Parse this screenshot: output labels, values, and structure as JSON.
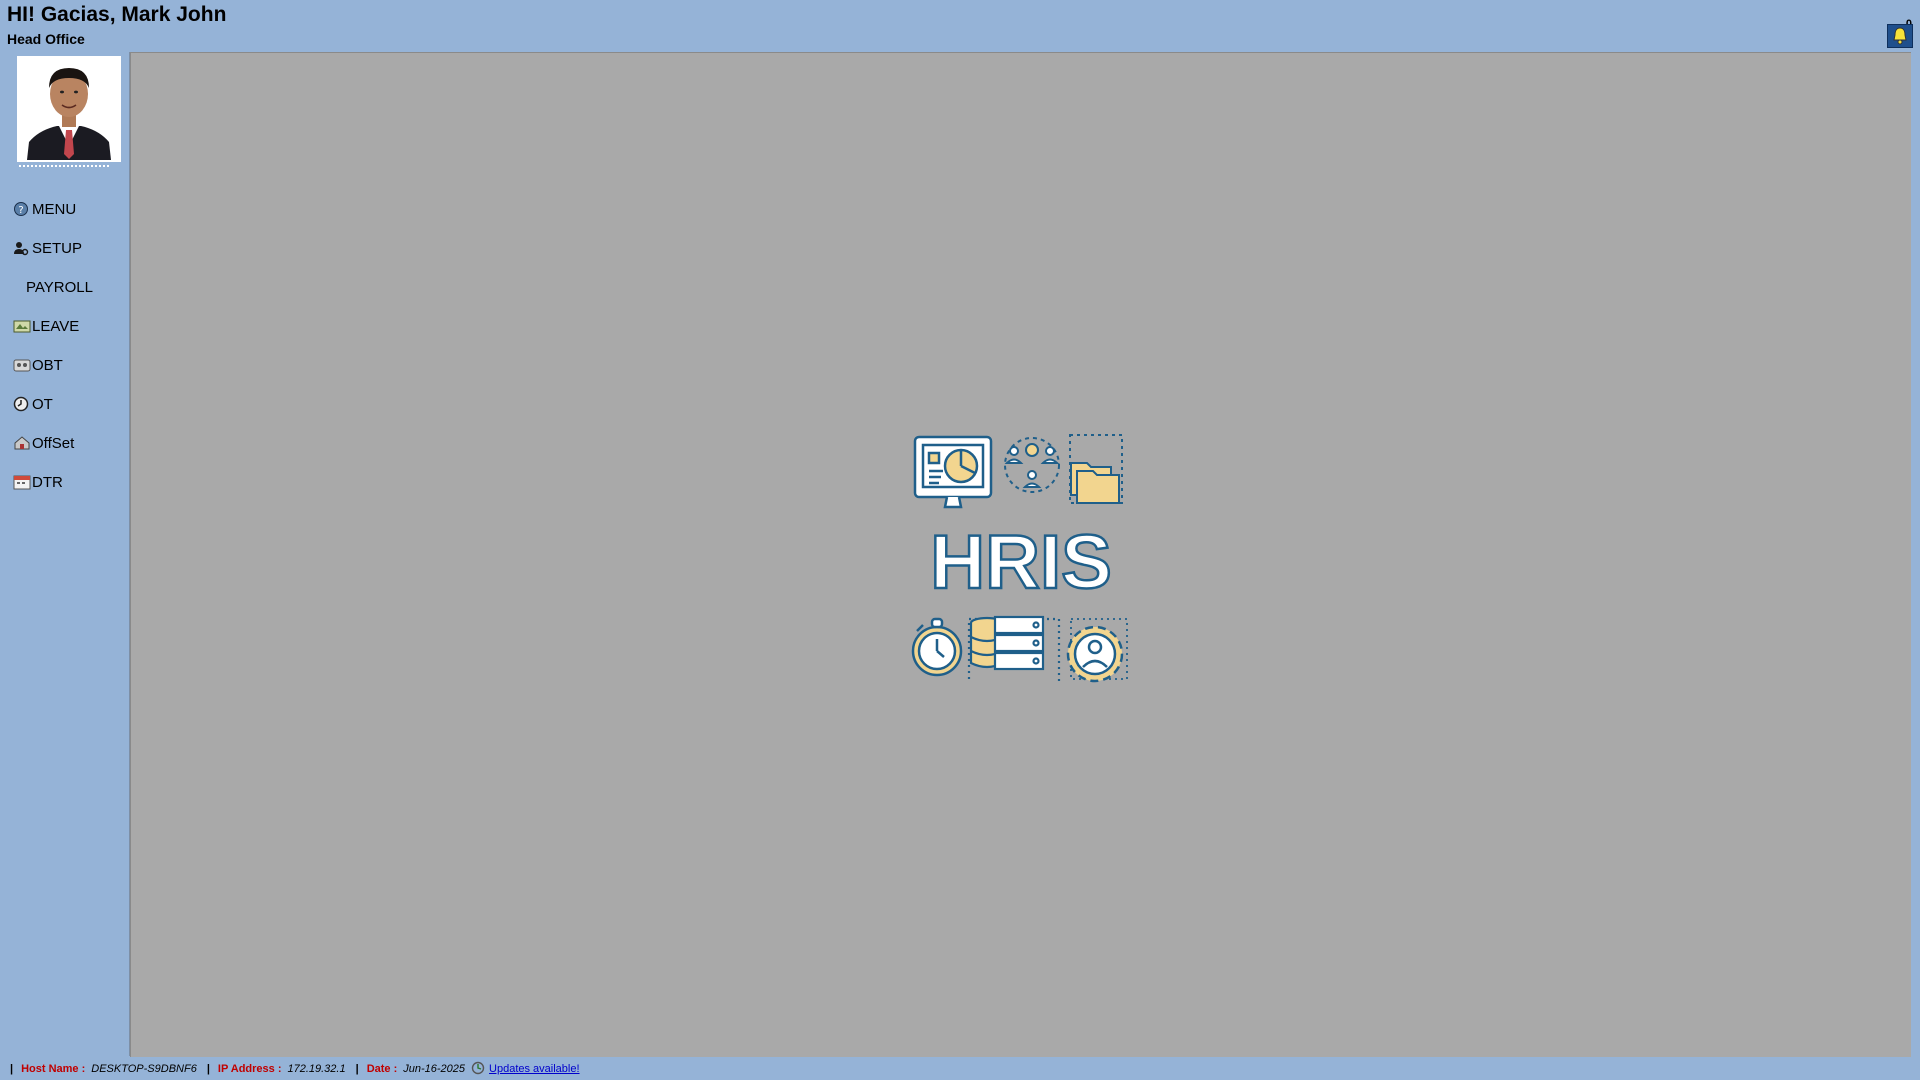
{
  "header": {
    "greeting": "HI! Gacias, Mark John",
    "office": "Head Office",
    "notification_count": "0"
  },
  "sidebar": {
    "items": [
      {
        "label": "MENU",
        "icon": "menu-icon"
      },
      {
        "label": "SETUP",
        "icon": "user-gear-icon"
      },
      {
        "label": "PAYROLL",
        "icon": ""
      },
      {
        "label": "LEAVE",
        "icon": "leave-icon"
      },
      {
        "label": "OBT",
        "icon": "obt-icon"
      },
      {
        "label": "OT",
        "icon": "clock-icon"
      },
      {
        "label": "OffSet",
        "icon": "offset-icon"
      },
      {
        "label": "DTR",
        "icon": "calendar-icon"
      }
    ]
  },
  "main": {
    "logo_text": "HRIS"
  },
  "statusbar": {
    "host_label": "Host Name :",
    "host_value": "DESKTOP-S9DBNF6",
    "ip_label": "IP Address :",
    "ip_value": "172.19.32.1",
    "date_label": "Date :",
    "date_value": "Jun-16-2025",
    "updates_link": "Updates available!"
  },
  "colors": {
    "background": "#95b3d7",
    "content": "#a9a9a9",
    "logo_accent": "#f2d58f",
    "logo_outline": "#1f5f8a",
    "label_red": "#c00000"
  }
}
